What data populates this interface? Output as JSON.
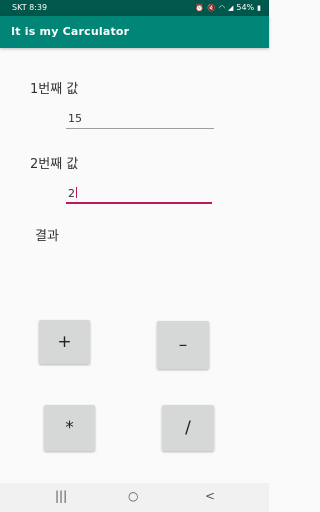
{
  "status_bar": {
    "carrier_time": "SKT 8:39",
    "icons": [
      "alarm-icon",
      "mute-icon",
      "wifi-icon",
      "signal-icon"
    ],
    "battery": "54%"
  },
  "app_bar": {
    "title": "It is my Carculator"
  },
  "form": {
    "first_label": "1번째 값",
    "first_value": "15",
    "second_label": "2번째 값",
    "second_value": "2",
    "result_label": "결과"
  },
  "buttons": {
    "add": "+",
    "subtract": "–",
    "multiply": "*",
    "divide": "/"
  },
  "nav_bar": {
    "recents": "|||",
    "home": "○",
    "back": "<"
  },
  "colors": {
    "primary": "#008577",
    "primary_dark": "#00574b",
    "accent": "#c2185b"
  }
}
